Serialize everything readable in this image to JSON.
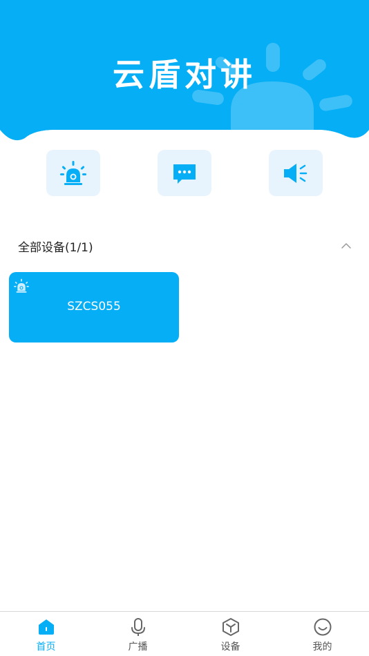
{
  "app": {
    "title": "云盾对讲"
  },
  "colors": {
    "primary": "#06aef5",
    "quick_bg": "#e8f4fd",
    "text": "#222222",
    "inactive": "#555555"
  },
  "quick_actions": [
    {
      "icon": "alarm-light-icon"
    },
    {
      "icon": "message-icon"
    },
    {
      "icon": "speaker-icon"
    }
  ],
  "devices_section": {
    "title": "全部设备(1/1)",
    "collapse_icon": "chevron-up-icon",
    "devices": [
      {
        "name": "SZCS055",
        "icon": "alarm-light-icon"
      }
    ]
  },
  "tabbar": {
    "tabs": [
      {
        "label": "首页",
        "icon": "home-icon",
        "active": true
      },
      {
        "label": "广播",
        "icon": "microphone-icon",
        "active": false
      },
      {
        "label": "设备",
        "icon": "cube-icon",
        "active": false
      },
      {
        "label": "我的",
        "icon": "smile-icon",
        "active": false
      }
    ]
  }
}
